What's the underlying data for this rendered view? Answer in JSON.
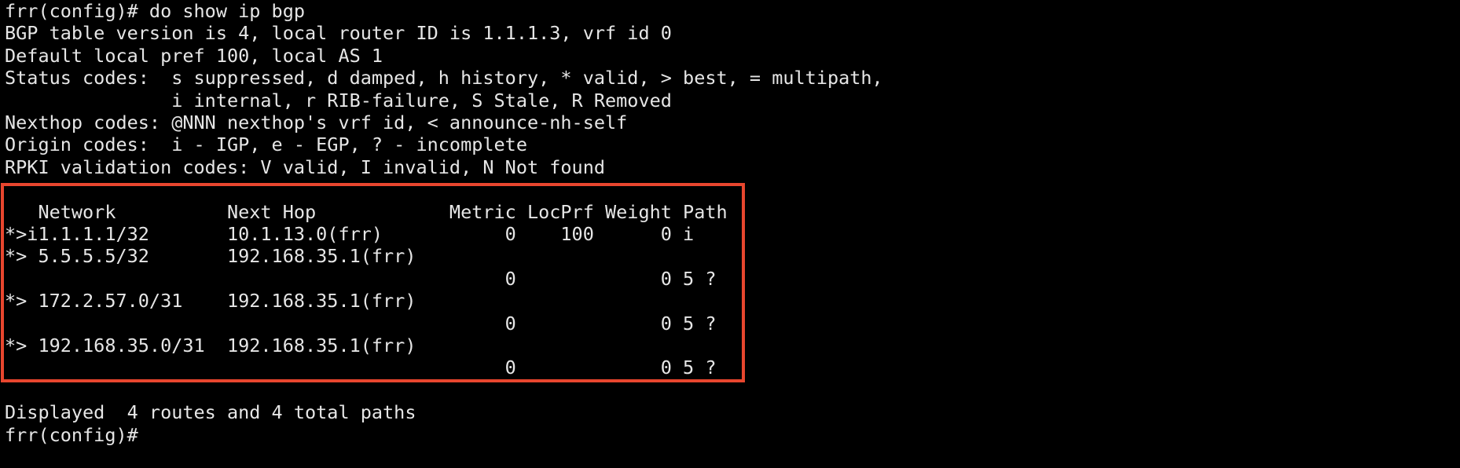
{
  "terminal": {
    "background": "#000000",
    "foreground": "#e6e6e6",
    "highlight_color": "#e8462e",
    "lines": [
      "frr(config)# do show ip bgp",
      "BGP table version is 4, local router ID is 1.1.1.3, vrf id 0",
      "Default local pref 100, local AS 1",
      "Status codes:  s suppressed, d damped, h history, * valid, > best, = multipath,",
      "               i internal, r RIB-failure, S Stale, R Removed",
      "Nexthop codes: @NNN nexthop's vrf id, < announce-nh-self",
      "Origin codes:  i - IGP, e - EGP, ? - incomplete",
      "RPKI validation codes: V valid, I invalid, N Not found",
      "",
      "   Network          Next Hop            Metric LocPrf Weight Path",
      "*>i1.1.1.1/32       10.1.13.0(frr)           0    100      0 i",
      "*> 5.5.5.5/32       192.168.35.1(frr)",
      "                                             0             0 5 ?",
      "*> 172.2.57.0/31    192.168.35.1(frr)",
      "                                             0             0 5 ?",
      "*> 192.168.35.0/31  192.168.35.1(frr)",
      "                                             0             0 5 ?",
      "",
      "Displayed  4 routes and 4 total paths",
      "frr(config)# "
    ]
  }
}
